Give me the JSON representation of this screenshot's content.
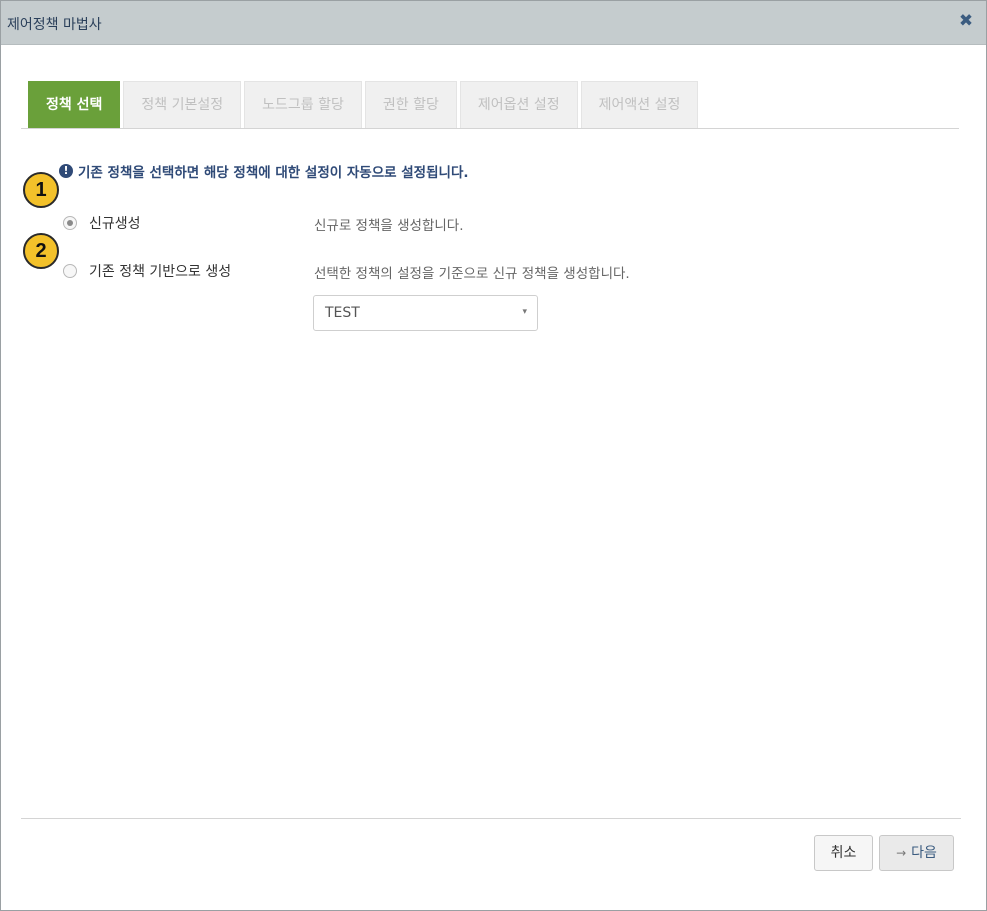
{
  "window": {
    "title": "제어정책 마법사",
    "close_icon": "close-icon"
  },
  "tabs": [
    {
      "label": "정책 선택",
      "active": true
    },
    {
      "label": "정책 기본설정",
      "active": false
    },
    {
      "label": "노드그룹 할당",
      "active": false
    },
    {
      "label": "권한 할당",
      "active": false
    },
    {
      "label": "제어옵션 설정",
      "active": false
    },
    {
      "label": "제어액션 설정",
      "active": false
    }
  ],
  "info": {
    "icon": "info-icon",
    "text": "기존 정책을 선택하면 해당 정책에 대한 설정이 자동으로 설정됩니다."
  },
  "badges": [
    "1",
    "2"
  ],
  "options": [
    {
      "label": "신규생성",
      "description": "신규로 정책을 생성합니다.",
      "checked": true
    },
    {
      "label": "기존 정책 기반으로 생성",
      "description": "선택한 정책의 설정을 기준으로 신규 정책을 생성합니다.",
      "checked": false
    }
  ],
  "policy_select": {
    "value": "TEST",
    "arrow": "▾"
  },
  "buttons": {
    "cancel": "취소",
    "next_arrow": "→",
    "next": "다음"
  },
  "colors": {
    "active_tab": "#6aa03a",
    "info_text": "#2f4a77",
    "badge": "#f3c12a",
    "titlebar": "#c5ccce"
  }
}
